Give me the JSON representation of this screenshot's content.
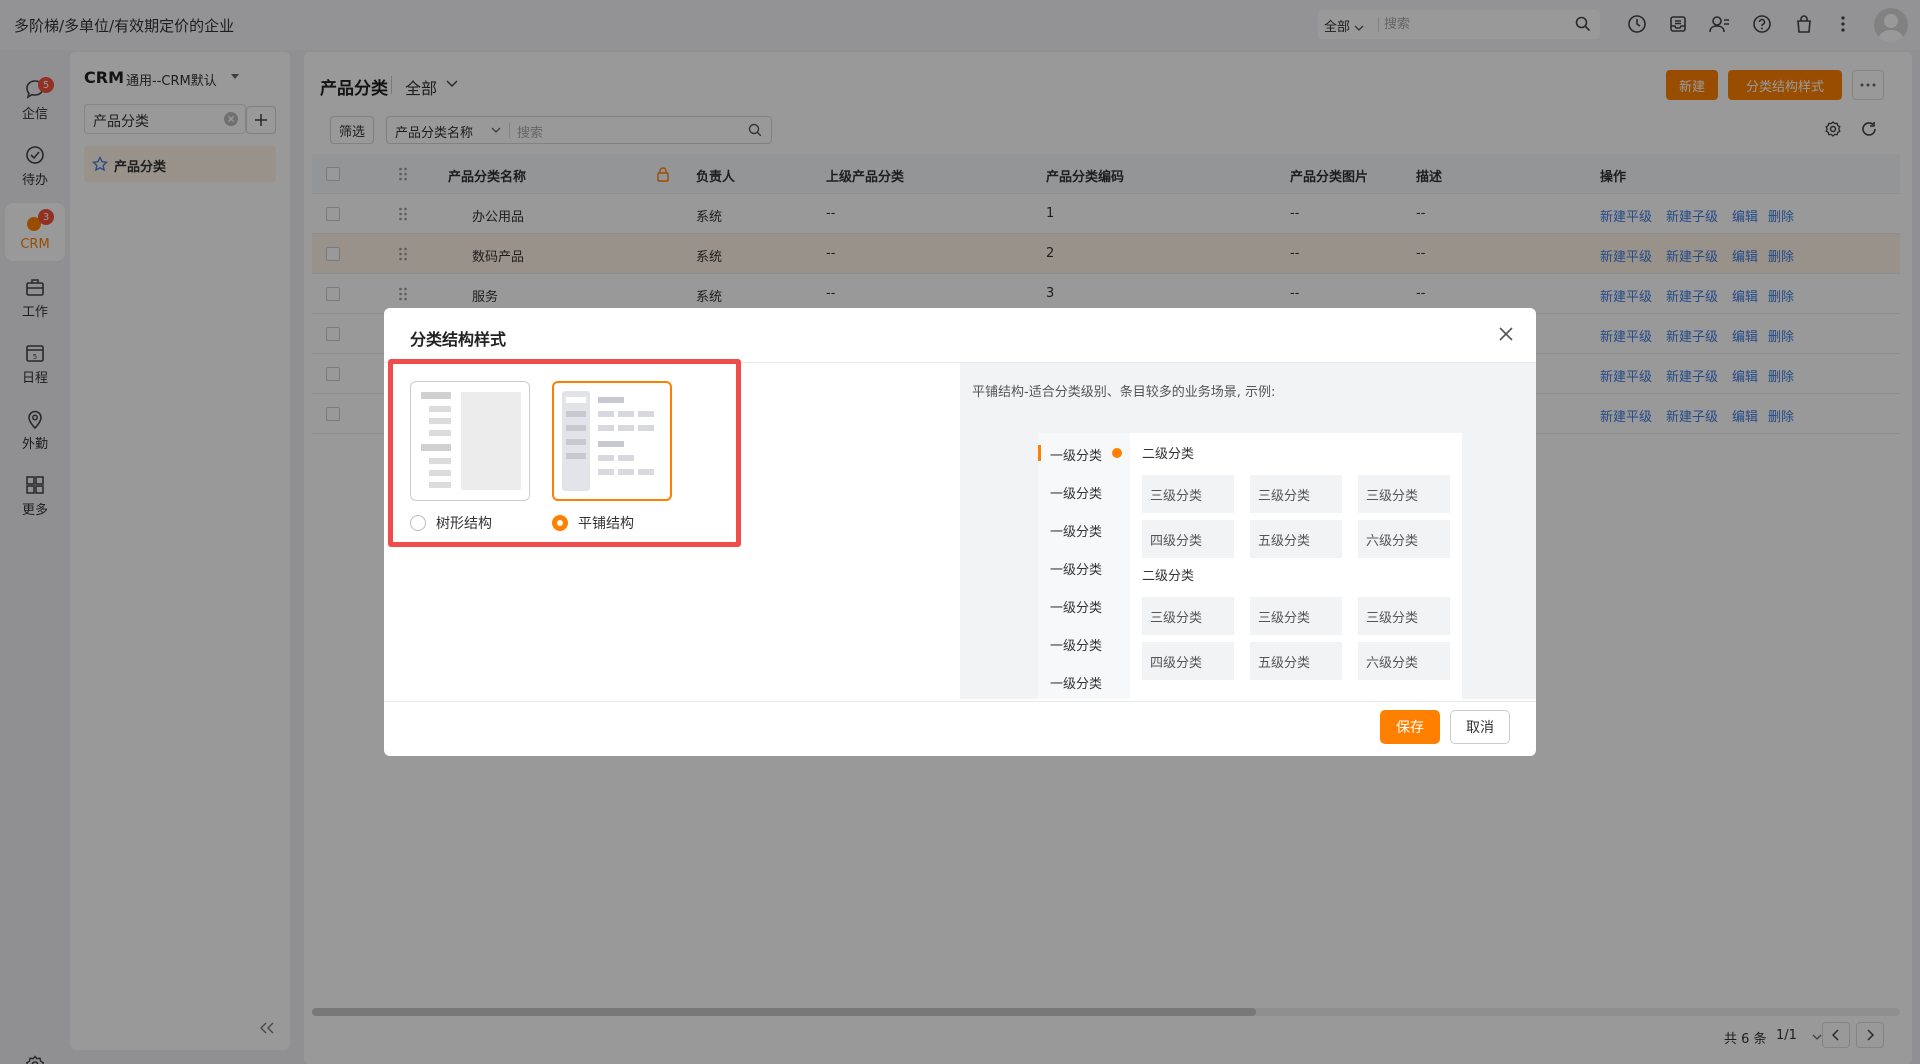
{
  "topbar": {
    "company": "多阶梯/多单位/有效期定价的企业",
    "search_scope": "全部",
    "search_placeholder": "搜索"
  },
  "leftnav": {
    "items": [
      {
        "label": "企信",
        "badge": "5",
        "icon": "chat-icon"
      },
      {
        "label": "待办",
        "badge": "",
        "icon": "todo-check-icon"
      },
      {
        "label": "CRM",
        "badge": "3",
        "icon": "crm-icon",
        "active": true
      },
      {
        "label": "工作",
        "badge": "",
        "icon": "briefcase-icon"
      },
      {
        "label": "日程",
        "badge": "",
        "icon": "calendar-icon"
      },
      {
        "label": "外勤",
        "badge": "",
        "icon": "location-icon"
      },
      {
        "label": "更多",
        "badge": "",
        "icon": "grid-icon"
      }
    ]
  },
  "sidepanel": {
    "title": "CRM",
    "subtitle": "通用--CRM默认",
    "search_value": "产品分类",
    "tree_item": "产品分类"
  },
  "main": {
    "title": "产品分类",
    "scope": "全部",
    "btn_new": "新建",
    "btn_style": "分类结构样式",
    "filter": "筛选",
    "filter_field": "产品分类名称",
    "filter_placeholder": "搜索",
    "columns": [
      "产品分类名称",
      "负责人",
      "上级产品分类",
      "产品分类编码",
      "产品分类图片",
      "描述",
      "操作"
    ],
    "rows": [
      {
        "name": "办公用品",
        "owner": "系统",
        "parent": "--",
        "code": "1",
        "image": "--",
        "desc": "--"
      },
      {
        "name": "数码产品",
        "owner": "系统",
        "parent": "--",
        "code": "2",
        "image": "--",
        "desc": "--"
      },
      {
        "name": "服务",
        "owner": "系统",
        "parent": "--",
        "code": "3",
        "image": "--",
        "desc": "--"
      },
      {
        "name": "",
        "owner": "",
        "parent": "",
        "code": "",
        "image": "",
        "desc": ""
      },
      {
        "name": "",
        "owner": "",
        "parent": "",
        "code": "",
        "image": "",
        "desc": ""
      },
      {
        "name": "",
        "owner": "",
        "parent": "",
        "code": "",
        "image": "",
        "desc": ""
      }
    ],
    "ops": [
      "新建平级",
      "新建子级",
      "编辑",
      "删除"
    ],
    "pager_total": "共 6 条",
    "pager_page": "1/1"
  },
  "modal": {
    "title": "分类结构样式",
    "option_tree": "树形结构",
    "option_flat": "平铺结构",
    "selected": "平铺结构",
    "desc": "平铺结构-适合分类级别、条目较多的业务场景, 示例:",
    "demo": {
      "level1": [
        "一级分类",
        "一级分类",
        "一级分类",
        "一级分类",
        "一级分类",
        "一级分类",
        "一级分类"
      ],
      "level2": [
        "二级分类",
        "二级分类"
      ],
      "grid": [
        "三级分类",
        "三级分类",
        "三级分类",
        "四级分类",
        "五级分类",
        "六级分类",
        "三级分类",
        "三级分类",
        "三级分类",
        "四级分类",
        "五级分类",
        "六级分类"
      ]
    },
    "save": "保存",
    "cancel": "取消"
  },
  "colors": {
    "accent": "#ff8000",
    "link": "#3e7ce0",
    "highlight_frame": "#f04c4c",
    "badge": "#f5503c"
  }
}
